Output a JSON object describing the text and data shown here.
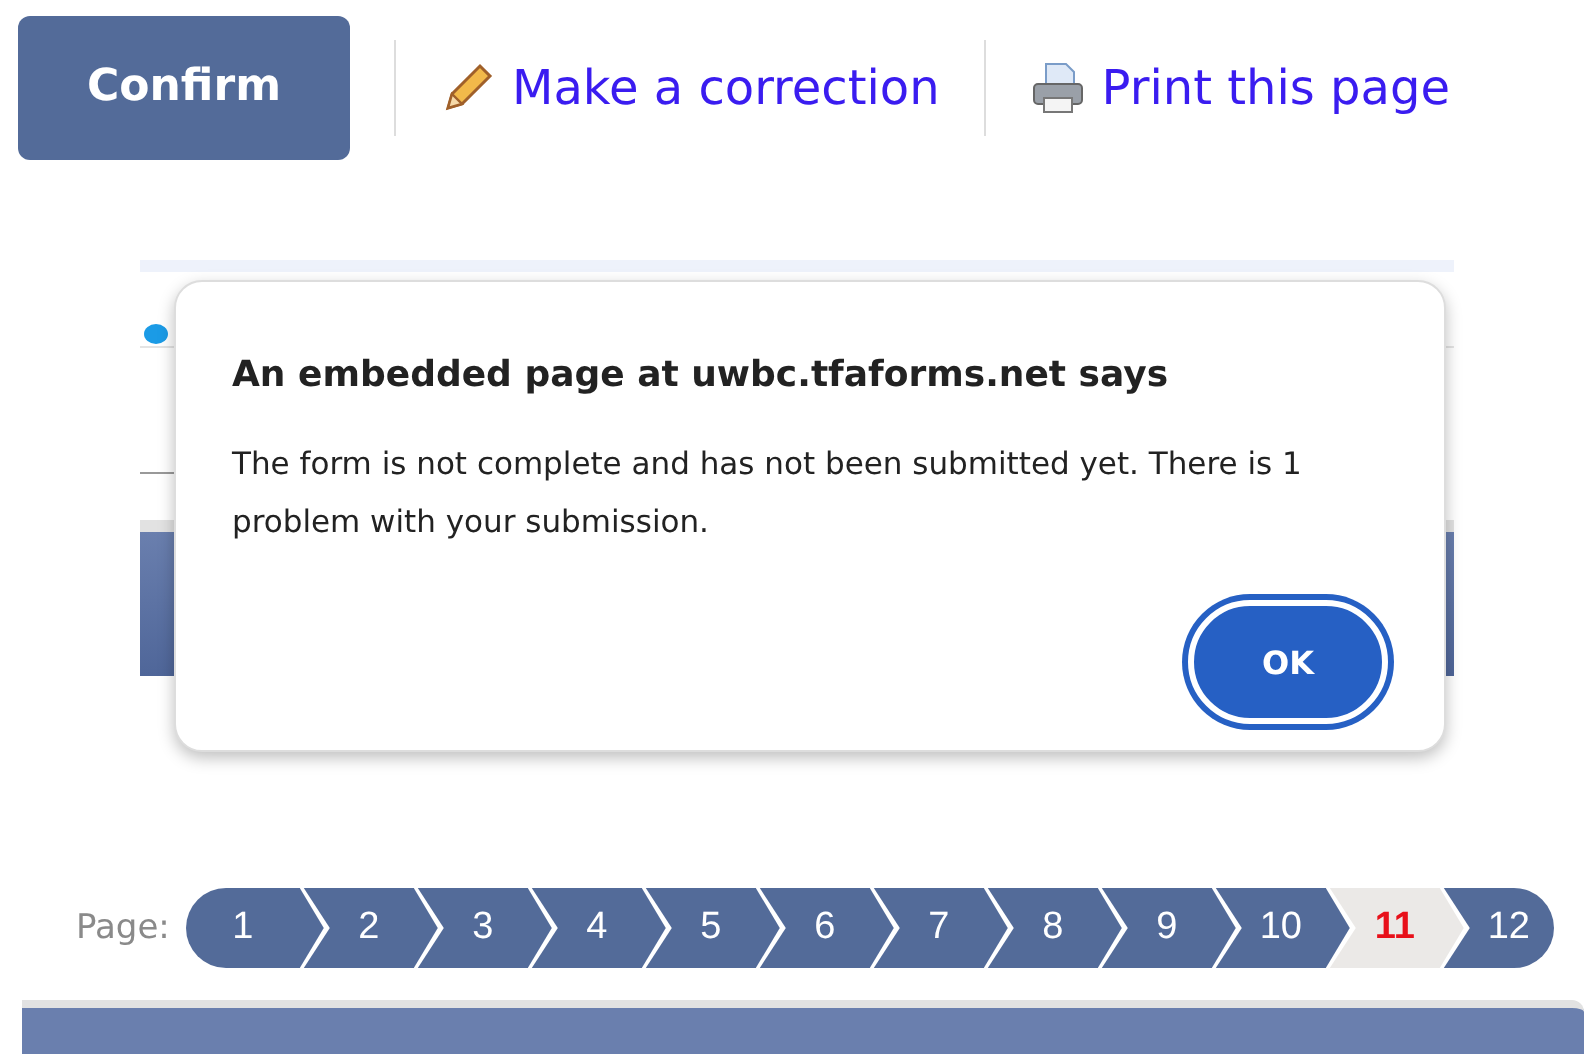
{
  "toolbar": {
    "confirm_button": "Confirm",
    "links": [
      {
        "kind": "edit",
        "label": "Make a correction"
      },
      {
        "kind": "print",
        "label": "Print this page"
      }
    ]
  },
  "dialog": {
    "title": "An embedded page at uwbc.tfaforms.net says",
    "message": "The form is not complete and has not been submitted yet. There is 1 problem with your submission.",
    "button": "OK"
  },
  "pager": {
    "label": "Page:",
    "pages": [
      {
        "label": "1",
        "selected": false
      },
      {
        "label": "2",
        "selected": false
      },
      {
        "label": "3",
        "selected": false
      },
      {
        "label": "4",
        "selected": false
      },
      {
        "label": "5",
        "selected": false
      },
      {
        "label": "6",
        "selected": false
      },
      {
        "label": "7",
        "selected": false
      },
      {
        "label": "8",
        "selected": false
      },
      {
        "label": "9",
        "selected": false
      },
      {
        "label": "10",
        "selected": false
      },
      {
        "label": "11",
        "selected": true
      },
      {
        "label": "12",
        "selected": false
      }
    ]
  }
}
